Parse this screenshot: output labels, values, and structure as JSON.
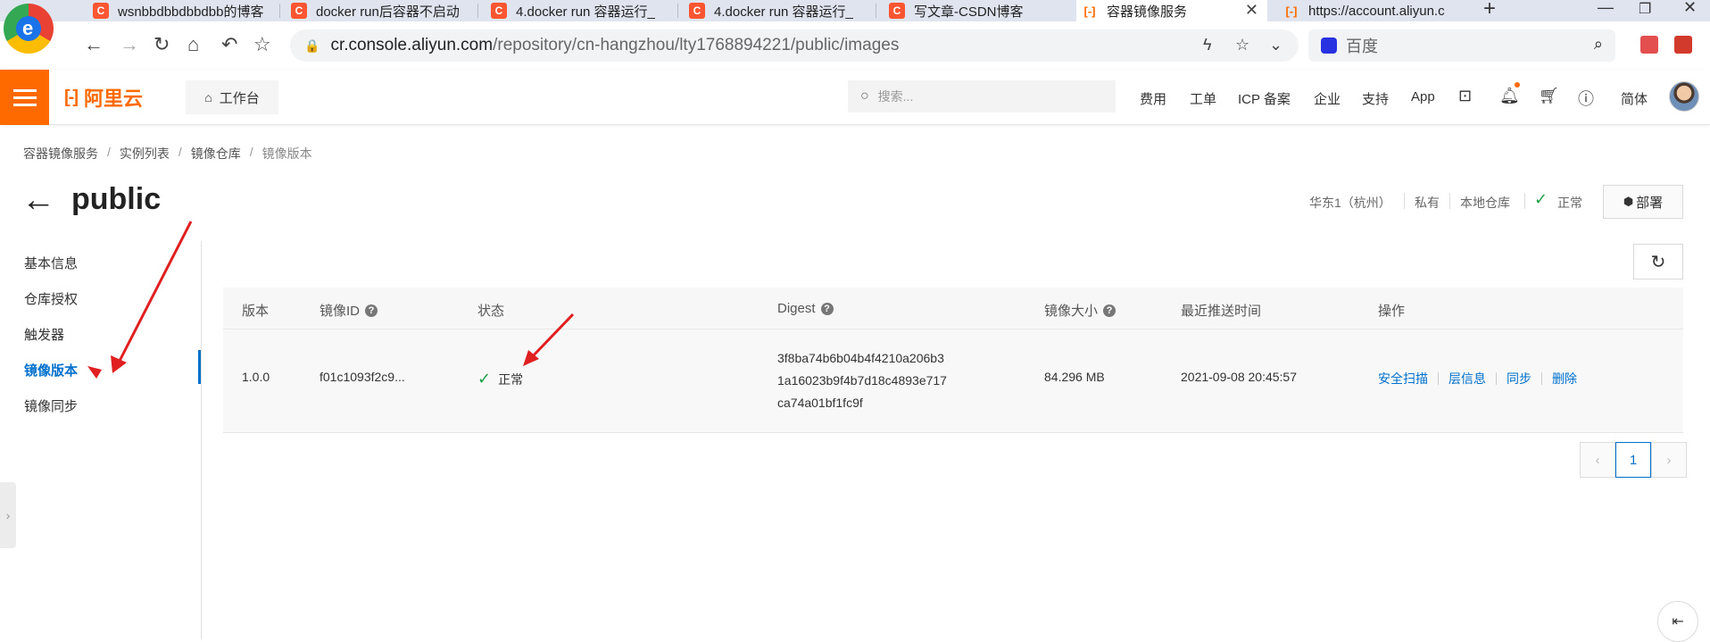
{
  "browser": {
    "tabs": [
      {
        "title": "wsnbbdbbdbbdbb的博客",
        "icon": "csdn-icon"
      },
      {
        "title": "docker run后容器不启动",
        "icon": "csdn-icon"
      },
      {
        "title": "4.docker run 容器运行_",
        "icon": "csdn-icon"
      },
      {
        "title": "4.docker run 容器运行_",
        "icon": "csdn-icon"
      },
      {
        "title": "写文章-CSDN博客",
        "icon": "csdn-icon"
      },
      {
        "title": "容器镜像服务",
        "icon": "aliyun-icon",
        "active": true
      },
      {
        "title": "https://account.aliyun.c",
        "icon": "aliyun-icon"
      }
    ],
    "url_host": "cr.console.aliyun.com",
    "url_path": "/repository/cn-hangzhou/lty1768894221/public/images",
    "search_engine": "百度"
  },
  "console": {
    "brand": "阿里云",
    "workbench": "工作台",
    "search_placeholder": "搜索...",
    "nav": {
      "fees": "费用",
      "tickets": "工单",
      "icp": "ICP 备案",
      "enterprise": "企业",
      "support": "支持",
      "app": "App",
      "language": "简体"
    },
    "accent": "#ff6a00",
    "link_color": "#0070cc"
  },
  "breadcrumb": [
    "容器镜像服务",
    "实例列表",
    "镜像仓库",
    "镜像版本"
  ],
  "page": {
    "title": "public",
    "region": "华东1（杭州）",
    "visibility": "私有",
    "repo_type": "本地仓库",
    "status": "正常",
    "deploy_label": "部署"
  },
  "sidebar": {
    "items": [
      {
        "label": "基本信息"
      },
      {
        "label": "仓库授权"
      },
      {
        "label": "触发器"
      },
      {
        "label": "镜像版本",
        "active": true
      },
      {
        "label": "镜像同步"
      }
    ]
  },
  "table": {
    "columns": [
      "版本",
      "镜像ID",
      "状态",
      "Digest",
      "镜像大小",
      "最近推送时间",
      "操作"
    ],
    "rows": [
      {
        "version": "1.0.0",
        "image_id": "f01c1093f2c9...",
        "status": "正常",
        "digest": [
          "3f8ba74b6b04b4f4210a206b3",
          "1a16023b9f4b7d18c4893e717",
          "ca74a01bf1fc9f"
        ],
        "size": "84.296 MB",
        "pushed_at": "2021-09-08 20:45:57",
        "actions": [
          "安全扫描",
          "层信息",
          "同步",
          "删除"
        ]
      }
    ]
  },
  "pagination": {
    "current": "1"
  }
}
